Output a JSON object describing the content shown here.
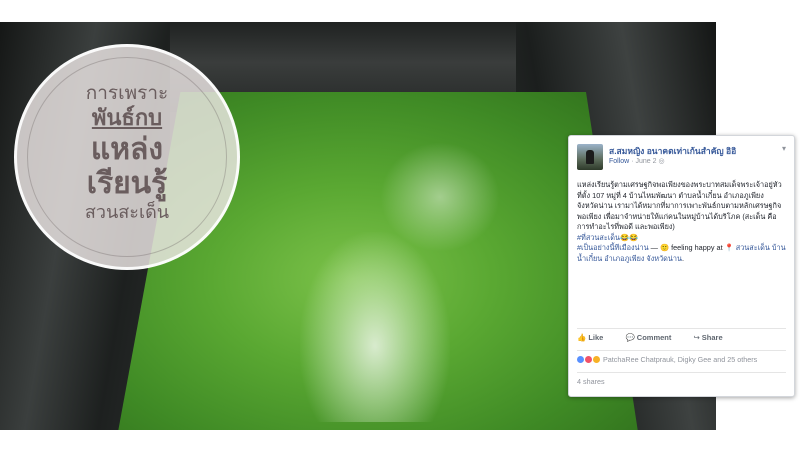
{
  "overlay": {
    "line1": "การเพราะ",
    "line2": "พันธ์กบ",
    "line3": "แหล่ง",
    "line4": "เรียนรู้",
    "line5": "สวนสะเด็น"
  },
  "post": {
    "page_name": "ส.สมหญิง อนาคตเท่าเก้นสำคัญ อิอิ",
    "follow": "Follow",
    "date": "June 2",
    "body": "แหล่งเรียนรู้ตามเศรษฐกิจพอเพียงของพระบาทสมเด็จพระเจ้าอยู่หัว ที่ตั้ง 107 หมู่ที่ 4 บ้านไหมพัฒนา ตำบลน้ำเกี๋ยน อำเภอภูเพียง จังหวัดน่าน เรามาได้หมากที่มาการเพาะพันธ์กบตามหลักเศรษฐกิจพอเพียง เพื่อมาจำหน่ายให้แก่คนในหมู่บ้านได้บริโภค (สะเด็น คือ การทำอะไรที่พอดี และพอเพียง)",
    "hashtag1": "#ที่สวนสะเด็น😂😂",
    "hashtag2": "#เป็นอย่างนี้ทีเมืองน่าน",
    "feeling": " — 🙂 feeling happy at ",
    "location": "📍 สวนสะเด็น บ้านน้ำเกี๋ยน อำเภอภูเพียง จังหวัดน่าน",
    "end": ".",
    "like_label": "Like",
    "comment_label": "Comment",
    "share_label": "Share",
    "reactions_text": "PatchaRee Chatprauk, Digky Gee and 25 others",
    "shares_text": "4 shares"
  },
  "icons": {
    "globe": "globe-icon",
    "chevron": "chevron-down-icon",
    "like": "thumbs-up-icon",
    "comment": "comment-icon",
    "share": "share-icon"
  }
}
